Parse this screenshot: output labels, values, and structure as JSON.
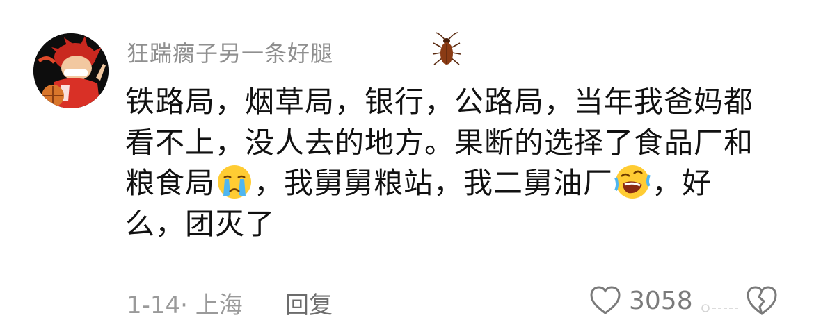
{
  "comment": {
    "username": "狂踹瘸子另一条好腿",
    "lines": [
      "铁路局，烟草局，银行，公路局，当年我爸妈都",
      "看不上，没人去的地方。果断的选择了食品厂和",
      "粮食局",
      "，我舅舅粮站，我二舅油厂",
      "，好",
      "么，团灭了"
    ],
    "date_location": "1-14· 上海",
    "reply_label": "回复",
    "like_count": "3058"
  },
  "icons": {
    "user_badge": "cockroach-icon",
    "emoji_1": "crying-face-emoji",
    "emoji_2": "rolling-laughing-emoji",
    "like": "heart-outline-icon",
    "dislike": "broken-heart-icon"
  },
  "colors": {
    "username": "#8f8f8f",
    "text": "#111111",
    "meta": "#9a9a9a",
    "emoji": "#ffcc33"
  }
}
